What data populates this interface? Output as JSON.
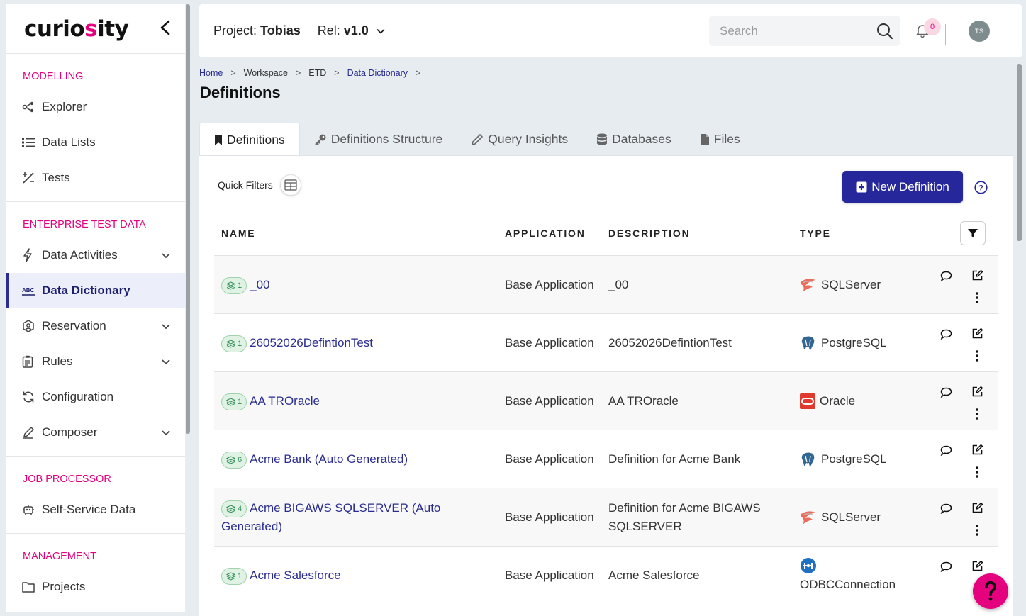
{
  "sidebar": {
    "logo": "curiosity",
    "sections": [
      {
        "title": "MODELLING",
        "items": [
          {
            "label": "Explorer",
            "icon": "explorer-icon"
          },
          {
            "label": "Data Lists",
            "icon": "list-icon"
          },
          {
            "label": "Tests",
            "icon": "tests-icon"
          }
        ]
      },
      {
        "title": "ENTERPRISE TEST DATA",
        "items": [
          {
            "label": "Data Activities",
            "icon": "bolt-icon"
          },
          {
            "label": "Data Dictionary",
            "icon": "abc-icon"
          },
          {
            "label": "Reservation",
            "icon": "reservation-icon"
          },
          {
            "label": "Rules",
            "icon": "rules-icon"
          },
          {
            "label": "Configuration",
            "icon": "sync-icon"
          },
          {
            "label": "Composer",
            "icon": "pencil-icon"
          }
        ]
      },
      {
        "title": "JOB PROCESSOR",
        "items": [
          {
            "label": "Self-Service Data",
            "icon": "robot-icon"
          }
        ]
      },
      {
        "title": "MANAGEMENT",
        "items": [
          {
            "label": "Projects",
            "icon": "folder-icon"
          }
        ]
      }
    ]
  },
  "topbar": {
    "project_label": "Project:",
    "project_name": "Tobias",
    "rel_label": "Rel:",
    "rel_value": "v1.0",
    "search_placeholder": "Search",
    "notification_count": "0",
    "avatar_initials": "TS"
  },
  "breadcrumb": [
    "Home",
    "Workspace",
    "ETD",
    "Data Dictionary"
  ],
  "page_title": "Definitions",
  "tabs": [
    "Definitions",
    "Definitions Structure",
    "Query Insights",
    "Databases",
    "Files"
  ],
  "toolbar": {
    "quick_filters": "Quick Filters",
    "new_definition": "New Definition"
  },
  "table": {
    "headers": [
      "NAME",
      "APPLICATION",
      "DESCRIPTION",
      "TYPE"
    ],
    "rows": [
      {
        "version": "1",
        "name": "_00",
        "application": "Base Application",
        "description": "_00",
        "type": "SQLServer"
      },
      {
        "version": "1",
        "name": "26052026DefintionTest",
        "application": "Base Application",
        "description": "26052026DefintionTest",
        "type": "PostgreSQL"
      },
      {
        "version": "1",
        "name": "AA TROracle",
        "application": "Base Application",
        "description": "AA TROracle",
        "type": "Oracle"
      },
      {
        "version": "6",
        "name": "Acme Bank (Auto Generated)",
        "application": "Base Application",
        "description": "Definition for Acme Bank",
        "type": "PostgreSQL"
      },
      {
        "version": "4",
        "name": "Acme BIGAWS SQLSERVER (Auto Generated)",
        "application": "Base Application",
        "description": "Definition for Acme BIGAWS SQLSERVER",
        "type": "SQLServer"
      },
      {
        "version": "1",
        "name": "Acme Salesforce",
        "application": "Base Application",
        "description": "Acme Salesforce",
        "type": "ODBCConnection"
      }
    ]
  },
  "colors": {
    "accent": "#e5007e",
    "primary": "#25279a",
    "link": "#2a2d8f"
  }
}
